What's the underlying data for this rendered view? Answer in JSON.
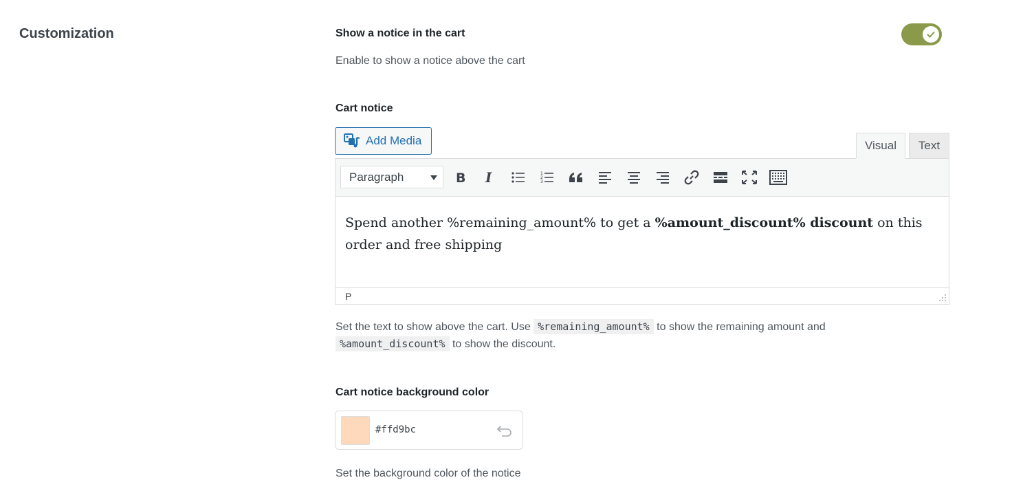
{
  "section": {
    "title": "Customization"
  },
  "show_notice": {
    "label": "Show a notice in the cart",
    "help": "Enable to show a notice above the cart",
    "enabled": true,
    "toggle_color": "#8a9a4a"
  },
  "cart_notice": {
    "label": "Cart notice",
    "add_media_label": "Add Media",
    "tabs": {
      "visual": "Visual",
      "text": "Text",
      "active": "Visual"
    },
    "format_select": "Paragraph",
    "toolbar_icons": [
      "bold-icon",
      "italic-icon",
      "bullet-list-icon",
      "numbered-list-icon",
      "blockquote-icon",
      "align-left-icon",
      "align-center-icon",
      "align-right-icon",
      "link-icon",
      "read-more-icon",
      "fullscreen-icon",
      "toolbar-toggle-icon"
    ],
    "content": {
      "before": "Spend another %remaining_amount% to get a ",
      "bold": "%amount_discount% discount",
      "after": " on this order and free shipping"
    },
    "status_path": "P",
    "help": {
      "part1": "Set the text to show above the cart. Use ",
      "code1": "%remaining_amount%",
      "part2": " to show the remaining amount and",
      "code2": "%amount_discount%",
      "part3": " to show the discount."
    }
  },
  "bg_color": {
    "label": "Cart notice background color",
    "value": "#ffd9bc",
    "help": "Set the background color of the notice"
  }
}
